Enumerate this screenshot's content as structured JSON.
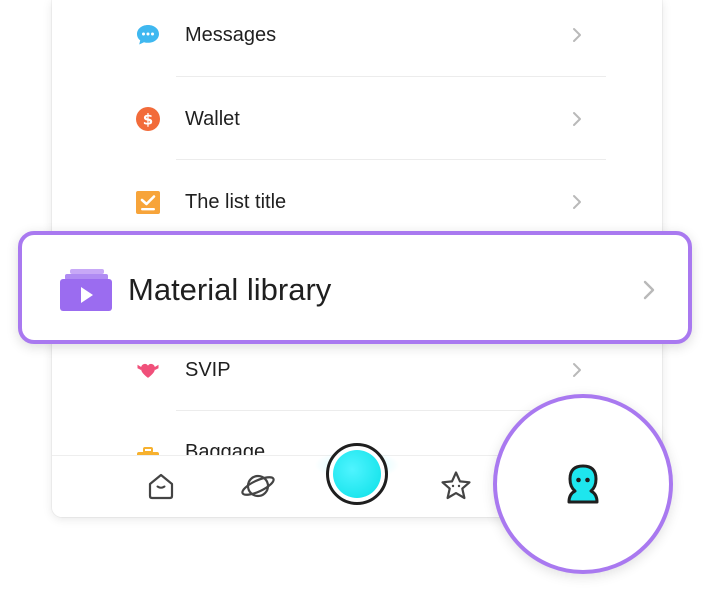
{
  "menu": {
    "items": [
      {
        "label": "Messages",
        "icon": "chat-bubble-icon",
        "color": "#3fb8f0"
      },
      {
        "label": "Wallet",
        "icon": "dollar-coin-icon",
        "color": "#f26b3a"
      },
      {
        "label": "The list title",
        "icon": "checklist-icon",
        "color": "#f7a43a"
      },
      {
        "label": "SVIP",
        "icon": "winged-heart-icon",
        "color": "#f0507a"
      },
      {
        "label": "Baggage",
        "icon": "baggage-icon",
        "color": "#f7b12e"
      }
    ]
  },
  "highlight": {
    "label": "Material library",
    "icon": "video-library-icon",
    "color": "#9b6cf0"
  },
  "tabbar": {
    "tabs": [
      {
        "name": "home",
        "icon": "home-icon"
      },
      {
        "name": "discover",
        "icon": "planet-icon"
      },
      {
        "name": "create",
        "icon": "record-button-icon"
      },
      {
        "name": "favorites",
        "icon": "star-icon"
      },
      {
        "name": "profile",
        "icon": "profile-avatar-icon"
      }
    ],
    "accent": "#1ee6ee"
  },
  "colors": {
    "highlight_border": "#a979f0",
    "text": "#1f1f1f"
  }
}
